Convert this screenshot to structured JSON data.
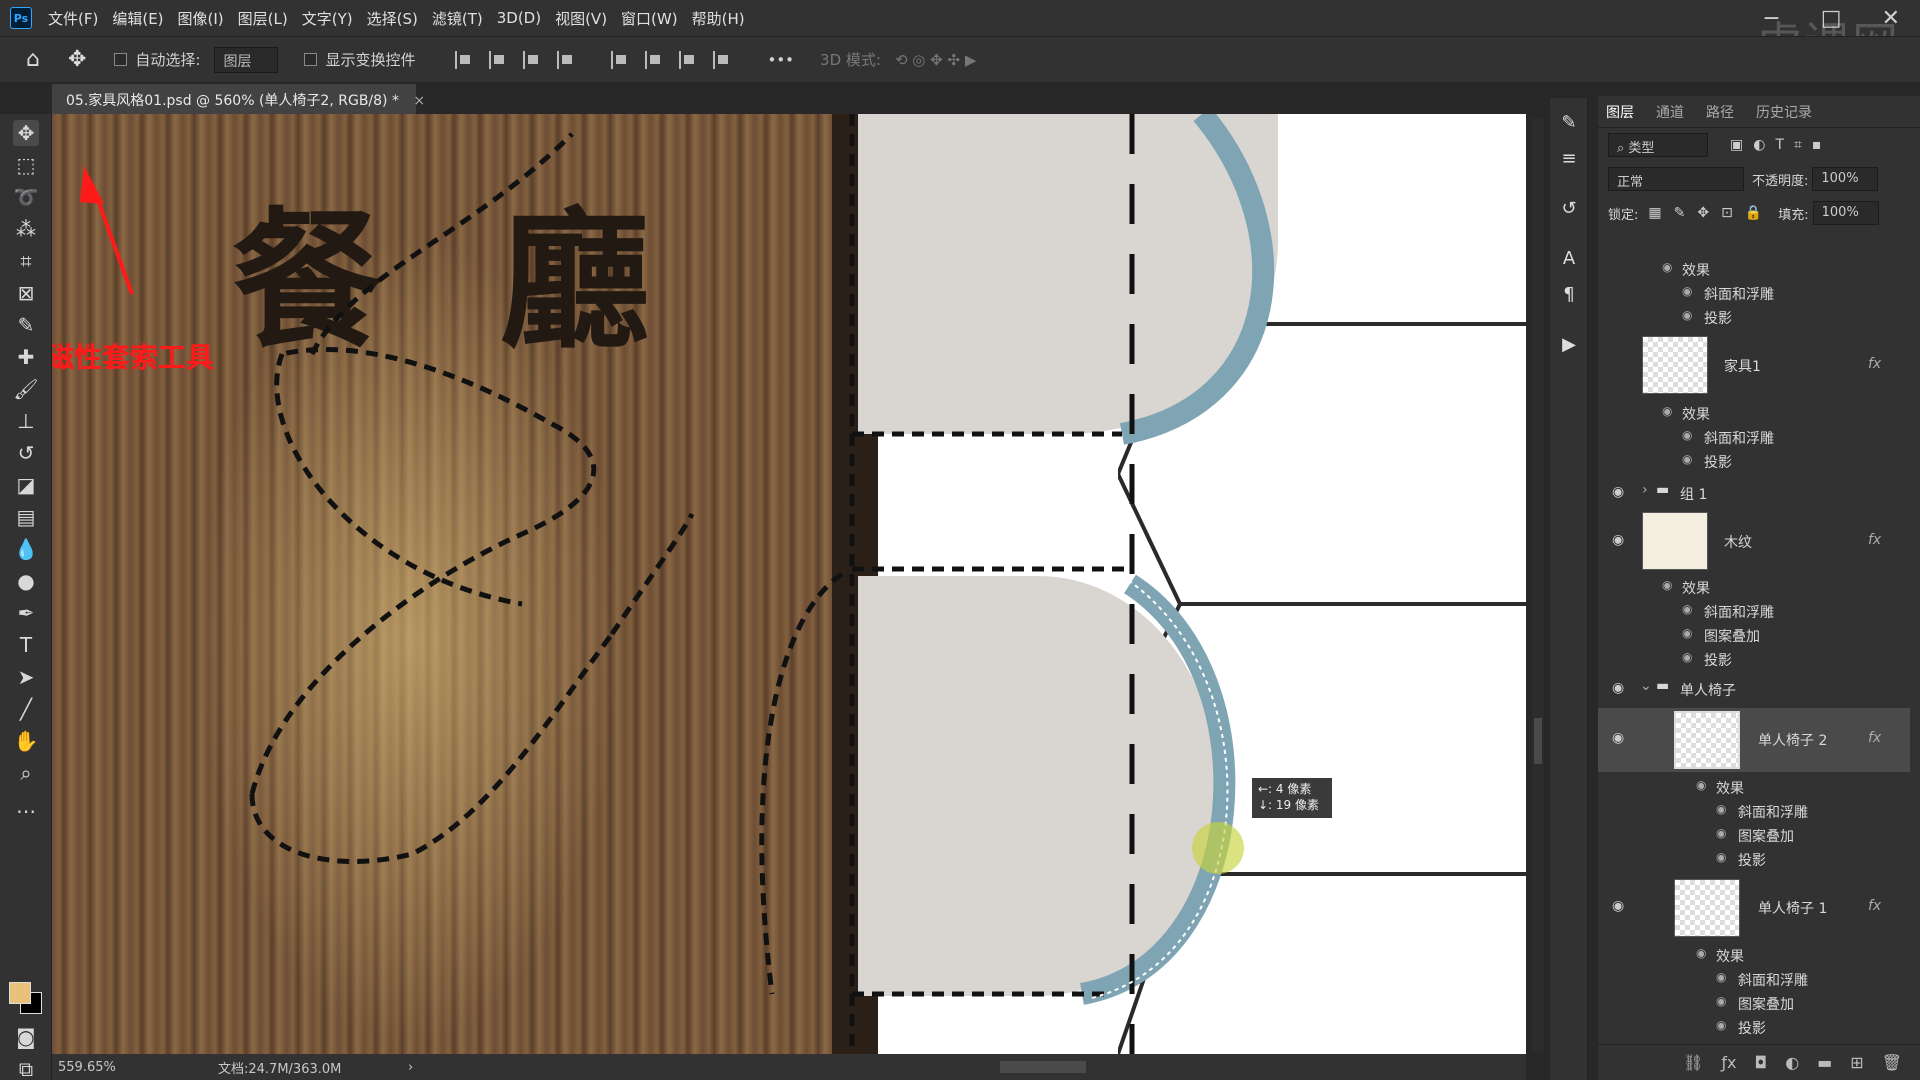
{
  "menu": {
    "logo": "Ps",
    "items": [
      "文件(F)",
      "编辑(E)",
      "图像(I)",
      "图层(L)",
      "文字(Y)",
      "选择(S)",
      "滤镜(T)",
      "3D(D)",
      "视图(V)",
      "窗口(W)",
      "帮助(H)"
    ]
  },
  "watermark": "虎课网",
  "options": {
    "auto_select_label": "自动选择:",
    "auto_select_value": "图层",
    "show_transform_label": "显示变换控件",
    "mode_3d_label": "3D 模式:"
  },
  "document_tab": {
    "title": "05.家具风格01.psd @ 560% (单人椅子2, RGB/8) *",
    "close": "×"
  },
  "canvas": {
    "sign_char_1": "餐",
    "sign_char_2": "廳",
    "annotation": "磁性套索工具",
    "tooltip_line_1": "←: 4 像素",
    "tooltip_line_2": "↓: 19 像素"
  },
  "status": {
    "zoom": "559.65%",
    "doc_size": "文档:24.7M/363.0M"
  },
  "layers_panel": {
    "tabs": [
      "图层",
      "通道",
      "路径",
      "历史记录"
    ],
    "filter_kind": "类型",
    "blend_mode": "正常",
    "opacity_label": "不透明度:",
    "opacity_value": "100%",
    "lock_label": "锁定:",
    "fill_label": "填充:",
    "fill_value": "100%",
    "effects_label": "效果",
    "bevel": "斜面和浮雕",
    "pattern": "图案叠加",
    "shadow": "投影",
    "layers": {
      "furniture1": "家具1",
      "group1": "组 1",
      "wood": "木纹",
      "chair_group": "单人椅子",
      "chair2": "单人椅子 2",
      "chair1": "单人椅子 1"
    },
    "fx": "fx"
  },
  "colors": {
    "annotation": "#ff1a1a",
    "foreground": "#e8c27a",
    "background": "#000000"
  }
}
